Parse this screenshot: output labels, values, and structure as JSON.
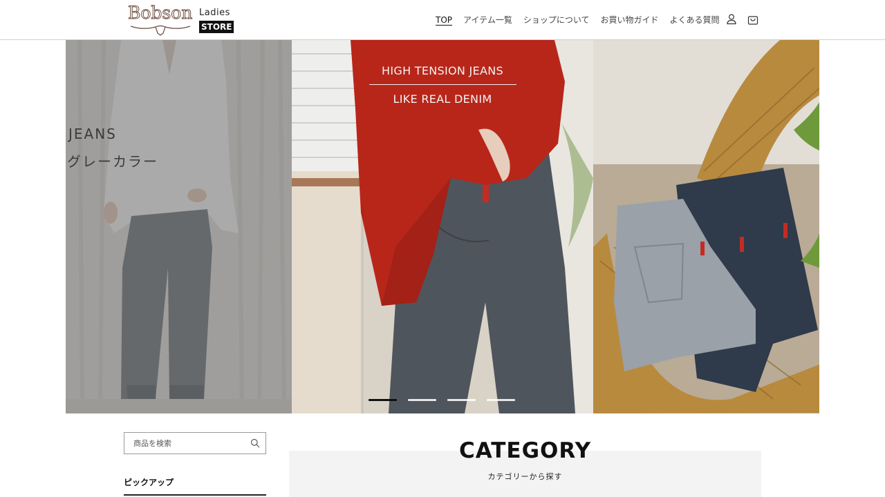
{
  "header": {
    "logo": {
      "brand": "Bobson",
      "ladies": "Ladies",
      "store": "STORE"
    },
    "nav": [
      {
        "label": "TOP",
        "active": true
      },
      {
        "label": "アイテム一覧",
        "active": false
      },
      {
        "label": "ショップについて",
        "active": false
      },
      {
        "label": "お買い物ガイド",
        "active": false
      },
      {
        "label": "よくある質問",
        "active": false
      }
    ],
    "icons": {
      "account": "user-icon",
      "cart": "cart-icon"
    }
  },
  "hero": {
    "left": {
      "title": "JEANS",
      "subtitle": "グレーカラー"
    },
    "center": {
      "line1": "HIGH TENSION JEANS",
      "line2": "LIKE  REAL DENIM"
    },
    "slides_count": 4,
    "active_slide": 1
  },
  "sidebar": {
    "search": {
      "placeholder": "商品を検索",
      "value": "",
      "icon": "search-icon"
    },
    "pickup_title": "ピックアップ"
  },
  "category": {
    "title": "CATEGORY",
    "subtitle": "カテゴリーから探す"
  },
  "colors": {
    "accent": "#111111",
    "sweater_red": "#b8261a",
    "denim_dark": "#2f3a4a",
    "denim_grey": "#8c949c"
  }
}
